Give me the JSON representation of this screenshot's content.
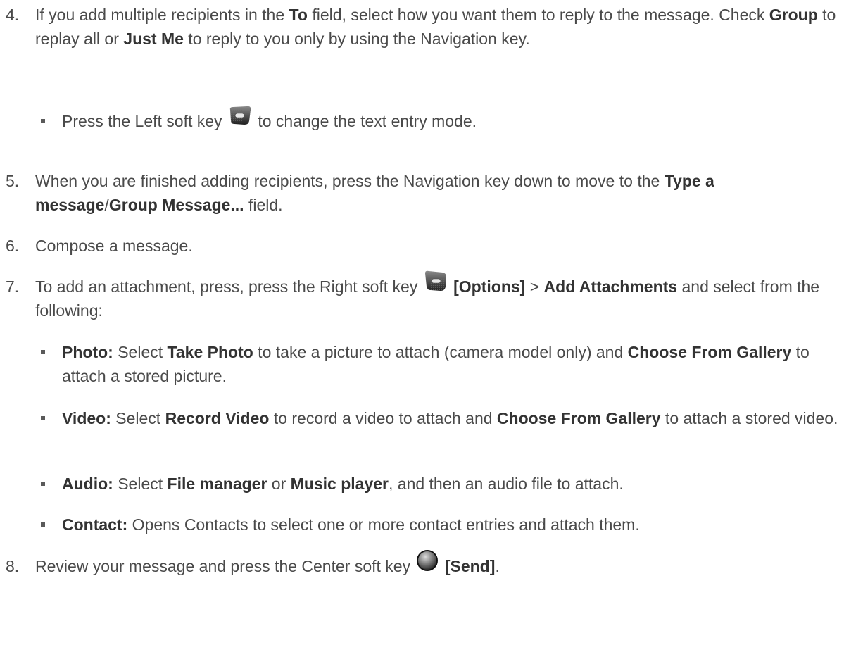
{
  "steps": [
    {
      "number": "4.",
      "segments": [
        {
          "t": "If you add multiple recipients in the ",
          "b": false
        },
        {
          "t": "To",
          "b": true
        },
        {
          "t": " field, select how you want them to reply to the message. Check ",
          "b": false
        },
        {
          "t": "Group",
          "b": true
        },
        {
          "t": " to replay all or ",
          "b": false
        },
        {
          "t": "Just Me",
          "b": true
        },
        {
          "t": " to reply to you only by using the Navigation key.",
          "b": false
        }
      ]
    },
    {
      "number": "5.",
      "segments": [
        {
          "t": "When you are finished adding recipients, press the Navigation key down to move to the ",
          "b": false
        },
        {
          "t": "Type a message",
          "b": true
        },
        {
          "t": "/",
          "b": false
        },
        {
          "t": "Group Message...",
          "b": true
        },
        {
          "t": " field.",
          "b": false
        }
      ]
    },
    {
      "number": "6.",
      "segments": [
        {
          "t": "Compose a message.",
          "b": false
        }
      ]
    },
    {
      "number": "7.",
      "segments": [
        {
          "t": "To add an attachment, press, press the Right soft key ",
          "b": false
        },
        {
          "icon": "right-soft-key-icon"
        },
        {
          "t": " [Options]",
          "b": true
        },
        {
          "t": " > ",
          "b": false
        },
        {
          "t": "Add Attachments",
          "b": true
        },
        {
          "t": " and select from the following:",
          "b": false
        }
      ]
    },
    {
      "number": "8.",
      "segments": [
        {
          "t": "Review your message and press the Center soft key ",
          "b": false
        },
        {
          "icon": "center-soft-key-icon"
        },
        {
          "t": " [Send]",
          "b": true
        },
        {
          "t": ".",
          "b": false
        }
      ]
    }
  ],
  "bullets": [
    {
      "segments": [
        {
          "t": "Press the Left soft key ",
          "b": false
        },
        {
          "icon": "left-soft-key-icon"
        },
        {
          "t": " to change the text entry mode.",
          "b": false
        }
      ]
    },
    {
      "segments": [
        {
          "t": "Photo:",
          "b": true
        },
        {
          "t": " Select ",
          "b": false
        },
        {
          "t": "Take Photo",
          "b": true
        },
        {
          "t": " to take a picture to attach (camera model only) and ",
          "b": false
        },
        {
          "t": "Choose From Gallery",
          "b": true
        },
        {
          "t": " to attach a stored picture.",
          "b": false
        }
      ]
    },
    {
      "segments": [
        {
          "t": "Video:",
          "b": true
        },
        {
          "t": " Select ",
          "b": false
        },
        {
          "t": "Record Video",
          "b": true
        },
        {
          "t": " to record a video to attach and ",
          "b": false
        },
        {
          "t": "Choose From Gallery",
          "b": true
        },
        {
          "t": " to attach a stored video.",
          "b": false
        }
      ]
    },
    {
      "segments": [
        {
          "t": "Audio:",
          "b": true
        },
        {
          "t": " Select ",
          "b": false
        },
        {
          "t": "File manager",
          "b": true
        },
        {
          "t": " or ",
          "b": false
        },
        {
          "t": "Music player",
          "b": true
        },
        {
          "t": ", and then an audio file to attach.",
          "b": false
        }
      ]
    },
    {
      "segments": [
        {
          "t": "Contact:",
          "b": true
        },
        {
          "t": " Opens Contacts to select one or more contact entries and attach them.",
          "b": false
        }
      ]
    }
  ]
}
